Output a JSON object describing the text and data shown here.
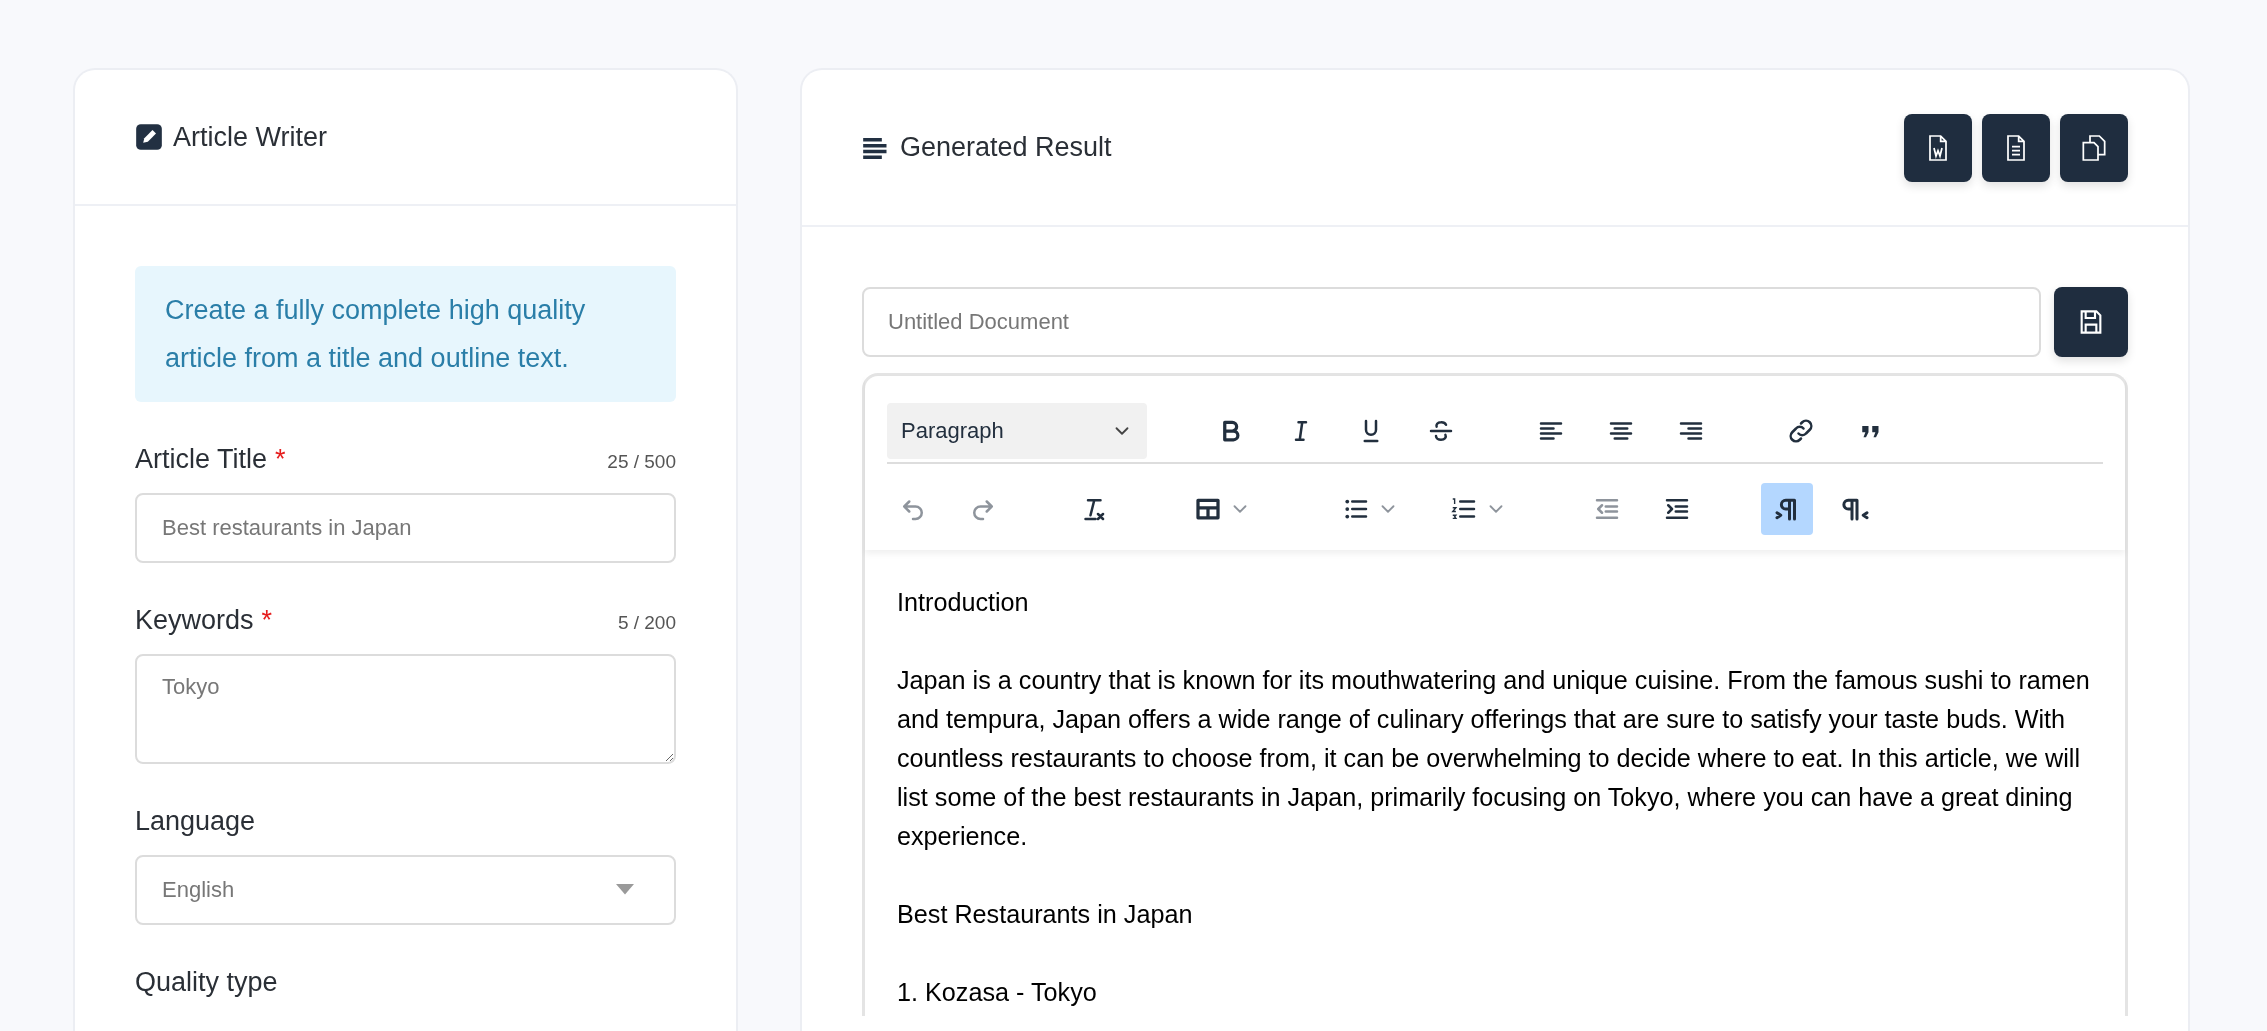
{
  "writer": {
    "title": "Article Writer",
    "info": "Create a fully complete high quality article from a title and outline text.",
    "fields": [
      {
        "kind": "input",
        "label": "Article Title",
        "required_mark": "*",
        "counter": "25 / 500",
        "placeholder": "Best restaurants in Japan"
      },
      {
        "kind": "textarea",
        "label": "Keywords",
        "required_mark": "*",
        "counter": "5 / 200",
        "placeholder": "Tokyo"
      },
      {
        "kind": "select",
        "label": "Language",
        "value": "English"
      },
      {
        "kind": "heading",
        "label": "Quality type"
      }
    ]
  },
  "result": {
    "title": "Generated Result",
    "actions": [
      {
        "kind": "word"
      },
      {
        "kind": "document"
      },
      {
        "kind": "copy"
      }
    ],
    "document_title": {
      "placeholder": "Untitled Document"
    },
    "editor": {
      "format": "Paragraph",
      "toolbar_rows": [
        [
          [
            {
              "kind": "bold",
              "on": false,
              "disabled": false
            },
            {
              "kind": "italic",
              "on": false,
              "disabled": false
            },
            {
              "kind": "underline",
              "on": false,
              "disabled": false
            },
            {
              "kind": "strike",
              "on": false,
              "disabled": false
            }
          ],
          [
            {
              "kind": "align-left",
              "on": false,
              "disabled": false
            },
            {
              "kind": "align-center",
              "on": false,
              "disabled": false
            },
            {
              "kind": "align-right",
              "on": false,
              "disabled": false
            }
          ],
          [
            {
              "kind": "link",
              "on": false,
              "disabled": false
            },
            {
              "kind": "quote",
              "on": false,
              "disabled": false
            }
          ]
        ],
        [
          [
            {
              "kind": "undo",
              "on": false,
              "disabled": true
            },
            {
              "kind": "redo",
              "on": false,
              "disabled": true
            }
          ],
          [
            {
              "kind": "clear-format",
              "on": false,
              "disabled": false
            }
          ],
          [
            {
              "kind": "table",
              "on": false,
              "disabled": false
            }
          ],
          [
            {
              "kind": "bullet-list",
              "on": false,
              "disabled": false
            },
            {
              "kind": "numbered-list",
              "on": false,
              "disabled": false
            }
          ],
          [
            {
              "kind": "outdent",
              "on": false,
              "disabled": true
            },
            {
              "kind": "indent",
              "on": false,
              "disabled": false
            }
          ],
          [
            {
              "kind": "ltr",
              "on": true,
              "disabled": false
            },
            {
              "kind": "rtl",
              "on": false,
              "disabled": false
            }
          ]
        ]
      ],
      "paragraphs": [
        "Introduction",
        "Japan is a country that is known for its mouthwatering and unique cuisine. From the famous sushi to ramen and tempura, Japan offers a wide range of culinary offerings that are sure to satisfy your taste buds. With countless restaurants to choose from, it can be overwhelming to decide where to eat. In this article, we will list some of the best restaurants in Japan, primarily focusing on Tokyo, where you can have a great dining experience.",
        "Best Restaurants in Japan",
        "1. Kozasa - Tokyo"
      ]
    }
  }
}
